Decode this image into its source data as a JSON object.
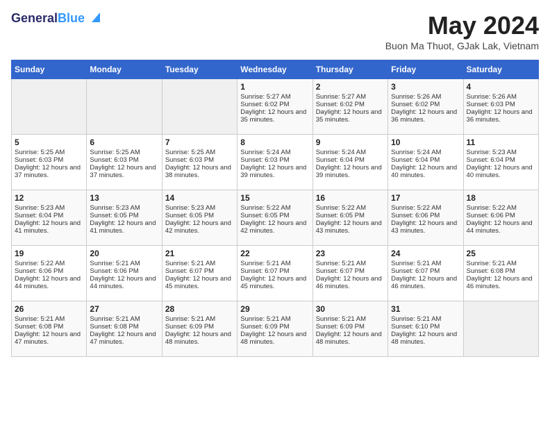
{
  "header": {
    "logo_line1": "General",
    "logo_line2": "Blue",
    "title": "May 2024",
    "location": "Buon Ma Thuot, GJak Lak, Vietnam"
  },
  "days_of_week": [
    "Sunday",
    "Monday",
    "Tuesday",
    "Wednesday",
    "Thursday",
    "Friday",
    "Saturday"
  ],
  "weeks": [
    [
      {
        "day": "",
        "empty": true
      },
      {
        "day": "",
        "empty": true
      },
      {
        "day": "",
        "empty": true
      },
      {
        "day": "1",
        "sunrise": "Sunrise: 5:27 AM",
        "sunset": "Sunset: 6:02 PM",
        "daylight": "Daylight: 12 hours and 35 minutes."
      },
      {
        "day": "2",
        "sunrise": "Sunrise: 5:27 AM",
        "sunset": "Sunset: 6:02 PM",
        "daylight": "Daylight: 12 hours and 35 minutes."
      },
      {
        "day": "3",
        "sunrise": "Sunrise: 5:26 AM",
        "sunset": "Sunset: 6:02 PM",
        "daylight": "Daylight: 12 hours and 36 minutes."
      },
      {
        "day": "4",
        "sunrise": "Sunrise: 5:26 AM",
        "sunset": "Sunset: 6:03 PM",
        "daylight": "Daylight: 12 hours and 36 minutes."
      }
    ],
    [
      {
        "day": "5",
        "sunrise": "Sunrise: 5:25 AM",
        "sunset": "Sunset: 6:03 PM",
        "daylight": "Daylight: 12 hours and 37 minutes."
      },
      {
        "day": "6",
        "sunrise": "Sunrise: 5:25 AM",
        "sunset": "Sunset: 6:03 PM",
        "daylight": "Daylight: 12 hours and 37 minutes."
      },
      {
        "day": "7",
        "sunrise": "Sunrise: 5:25 AM",
        "sunset": "Sunset: 6:03 PM",
        "daylight": "Daylight: 12 hours and 38 minutes."
      },
      {
        "day": "8",
        "sunrise": "Sunrise: 5:24 AM",
        "sunset": "Sunset: 6:03 PM",
        "daylight": "Daylight: 12 hours and 39 minutes."
      },
      {
        "day": "9",
        "sunrise": "Sunrise: 5:24 AM",
        "sunset": "Sunset: 6:04 PM",
        "daylight": "Daylight: 12 hours and 39 minutes."
      },
      {
        "day": "10",
        "sunrise": "Sunrise: 5:24 AM",
        "sunset": "Sunset: 6:04 PM",
        "daylight": "Daylight: 12 hours and 40 minutes."
      },
      {
        "day": "11",
        "sunrise": "Sunrise: 5:23 AM",
        "sunset": "Sunset: 6:04 PM",
        "daylight": "Daylight: 12 hours and 40 minutes."
      }
    ],
    [
      {
        "day": "12",
        "sunrise": "Sunrise: 5:23 AM",
        "sunset": "Sunset: 6:04 PM",
        "daylight": "Daylight: 12 hours and 41 minutes."
      },
      {
        "day": "13",
        "sunrise": "Sunrise: 5:23 AM",
        "sunset": "Sunset: 6:05 PM",
        "daylight": "Daylight: 12 hours and 41 minutes."
      },
      {
        "day": "14",
        "sunrise": "Sunrise: 5:23 AM",
        "sunset": "Sunset: 6:05 PM",
        "daylight": "Daylight: 12 hours and 42 minutes."
      },
      {
        "day": "15",
        "sunrise": "Sunrise: 5:22 AM",
        "sunset": "Sunset: 6:05 PM",
        "daylight": "Daylight: 12 hours and 42 minutes."
      },
      {
        "day": "16",
        "sunrise": "Sunrise: 5:22 AM",
        "sunset": "Sunset: 6:05 PM",
        "daylight": "Daylight: 12 hours and 43 minutes."
      },
      {
        "day": "17",
        "sunrise": "Sunrise: 5:22 AM",
        "sunset": "Sunset: 6:06 PM",
        "daylight": "Daylight: 12 hours and 43 minutes."
      },
      {
        "day": "18",
        "sunrise": "Sunrise: 5:22 AM",
        "sunset": "Sunset: 6:06 PM",
        "daylight": "Daylight: 12 hours and 44 minutes."
      }
    ],
    [
      {
        "day": "19",
        "sunrise": "Sunrise: 5:22 AM",
        "sunset": "Sunset: 6:06 PM",
        "daylight": "Daylight: 12 hours and 44 minutes."
      },
      {
        "day": "20",
        "sunrise": "Sunrise: 5:21 AM",
        "sunset": "Sunset: 6:06 PM",
        "daylight": "Daylight: 12 hours and 44 minutes."
      },
      {
        "day": "21",
        "sunrise": "Sunrise: 5:21 AM",
        "sunset": "Sunset: 6:07 PM",
        "daylight": "Daylight: 12 hours and 45 minutes."
      },
      {
        "day": "22",
        "sunrise": "Sunrise: 5:21 AM",
        "sunset": "Sunset: 6:07 PM",
        "daylight": "Daylight: 12 hours and 45 minutes."
      },
      {
        "day": "23",
        "sunrise": "Sunrise: 5:21 AM",
        "sunset": "Sunset: 6:07 PM",
        "daylight": "Daylight: 12 hours and 46 minutes."
      },
      {
        "day": "24",
        "sunrise": "Sunrise: 5:21 AM",
        "sunset": "Sunset: 6:07 PM",
        "daylight": "Daylight: 12 hours and 46 minutes."
      },
      {
        "day": "25",
        "sunrise": "Sunrise: 5:21 AM",
        "sunset": "Sunset: 6:08 PM",
        "daylight": "Daylight: 12 hours and 46 minutes."
      }
    ],
    [
      {
        "day": "26",
        "sunrise": "Sunrise: 5:21 AM",
        "sunset": "Sunset: 6:08 PM",
        "daylight": "Daylight: 12 hours and 47 minutes."
      },
      {
        "day": "27",
        "sunrise": "Sunrise: 5:21 AM",
        "sunset": "Sunset: 6:08 PM",
        "daylight": "Daylight: 12 hours and 47 minutes."
      },
      {
        "day": "28",
        "sunrise": "Sunrise: 5:21 AM",
        "sunset": "Sunset: 6:09 PM",
        "daylight": "Daylight: 12 hours and 48 minutes."
      },
      {
        "day": "29",
        "sunrise": "Sunrise: 5:21 AM",
        "sunset": "Sunset: 6:09 PM",
        "daylight": "Daylight: 12 hours and 48 minutes."
      },
      {
        "day": "30",
        "sunrise": "Sunrise: 5:21 AM",
        "sunset": "Sunset: 6:09 PM",
        "daylight": "Daylight: 12 hours and 48 minutes."
      },
      {
        "day": "31",
        "sunrise": "Sunrise: 5:21 AM",
        "sunset": "Sunset: 6:10 PM",
        "daylight": "Daylight: 12 hours and 48 minutes."
      },
      {
        "day": "",
        "empty": true
      }
    ]
  ]
}
